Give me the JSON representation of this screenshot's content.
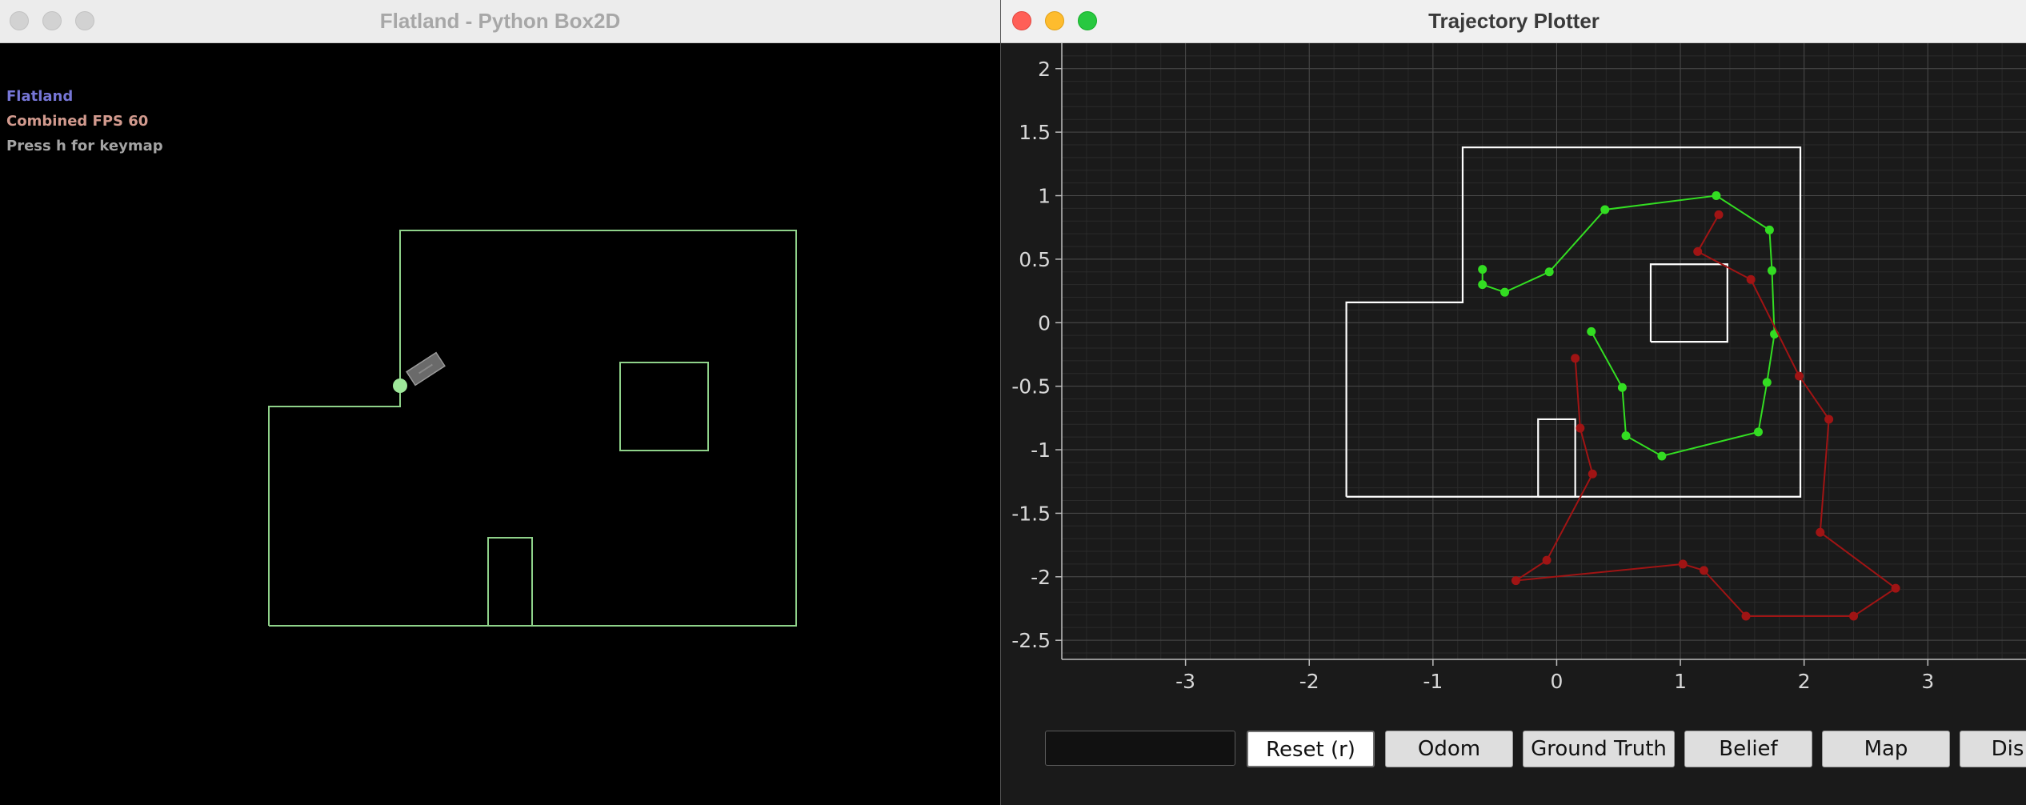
{
  "left_window": {
    "title": "Flatland - Python Box2D",
    "overlay": {
      "app_name": "Flatland",
      "fps": "Combined FPS 60",
      "help": "Press h for keymap"
    },
    "colors": {
      "walls": "#8fd28a",
      "robot_marker": "#9ee79a",
      "robot_body": "#6a6a6a"
    }
  },
  "right_window": {
    "title": "Trajectory Plotter",
    "input": {
      "value": "",
      "placeholder": ""
    },
    "buttons": {
      "reset": "Reset (r)",
      "odom": "Odom",
      "ground_truth": "Ground Truth",
      "belief": "Belief",
      "map": "Map",
      "dis": "Dis"
    }
  },
  "chart_data": {
    "type": "line",
    "title": "",
    "xlabel": "",
    "ylabel": "",
    "xlim": [
      -4.0,
      3.8
    ],
    "ylim": [
      -2.65,
      2.2
    ],
    "x_ticks": [
      "-3",
      "-2",
      "-1",
      "0",
      "1",
      "2",
      "3"
    ],
    "y_ticks": [
      "2",
      "1.5",
      "1",
      "0.5",
      "0",
      "-0.5",
      "-1",
      "-1.5",
      "-2",
      "-2.5"
    ],
    "grid": true,
    "map_outline": [
      [
        -1.7,
        -1.37
      ],
      [
        1.97,
        -1.37
      ],
      [
        1.97,
        1.38
      ],
      [
        -0.76,
        1.38
      ],
      [
        -0.76,
        0.16
      ],
      [
        -1.7,
        0.16
      ],
      [
        -1.7,
        -1.37
      ]
    ],
    "map_obstacles": [
      [
        [
          0.76,
          -0.15
        ],
        [
          1.38,
          -0.15
        ],
        [
          1.38,
          0.46
        ],
        [
          0.76,
          0.46
        ],
        [
          0.76,
          -0.15
        ]
      ],
      [
        [
          -0.15,
          -1.37
        ],
        [
          0.15,
          -1.37
        ],
        [
          0.15,
          -0.76
        ],
        [
          -0.15,
          -0.76
        ],
        [
          -0.15,
          -1.37
        ]
      ]
    ],
    "series": [
      {
        "color": "#33dd22",
        "x": [
          -0.6,
          -0.6,
          -0.42,
          -0.06,
          0.39,
          1.29,
          1.72,
          1.74,
          1.76,
          1.7,
          1.63,
          0.85,
          0.56,
          0.53,
          0.28
        ],
        "y": [
          0.42,
          0.3,
          0.24,
          0.4,
          0.89,
          1.0,
          0.73,
          0.41,
          -0.09,
          -0.47,
          -0.86,
          -1.05,
          -0.89,
          -0.51,
          -0.07
        ]
      },
      {
        "color": "#a01414",
        "x": [
          1.31,
          1.14,
          1.57,
          1.96,
          2.2,
          2.13,
          2.74,
          2.4,
          1.53,
          1.19,
          1.02,
          -0.33,
          -0.08,
          0.29,
          0.19,
          0.15
        ],
        "y": [
          0.85,
          0.56,
          0.34,
          -0.42,
          -0.76,
          -1.65,
          -2.09,
          -2.31,
          -2.31,
          -1.95,
          -1.9,
          -2.03,
          -1.87,
          -1.19,
          -0.83,
          -0.28
        ]
      }
    ]
  }
}
